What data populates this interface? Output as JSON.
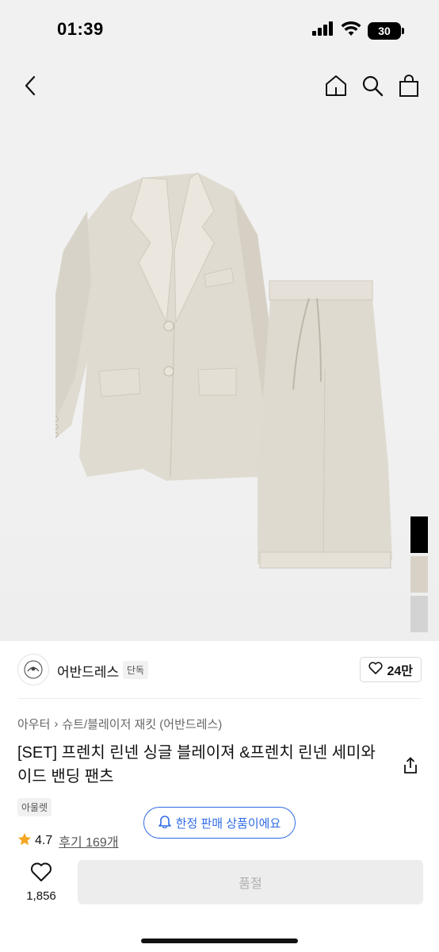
{
  "status_bar": {
    "time": "01:39",
    "battery": "30"
  },
  "nav": {
    "back_icon": "chevron-left-icon",
    "icons": [
      "home-icon",
      "search-icon",
      "shopping-bag-icon"
    ]
  },
  "product_image": {
    "description_icon": "linen-suit-set-image"
  },
  "swatches": [
    {
      "color": "#000000"
    },
    {
      "color": "#d8d2c6"
    },
    {
      "color": "#d3d3d3"
    }
  ],
  "brand": {
    "name": "어반드레스",
    "badge": "단독",
    "likes": "24만"
  },
  "breadcrumb": {
    "category": "아우터",
    "separator": "›",
    "subcategory": "슈트/블레이저 재킷 (어반드레스)"
  },
  "product": {
    "title": "[SET] 프렌치 린넨 싱글 블레이져 &프렌치 린넨 세미와이드 밴딩 팬츠",
    "outlet_tag": "아울렛",
    "limited_notice": "한정 판매 상품이에요"
  },
  "rating": {
    "value": "4.7",
    "reviews": "후기 169개",
    "star_color": "#f5a623"
  },
  "bottom_bar": {
    "wish_count": "1,856",
    "button_label": "품절"
  },
  "colors": {
    "accent": "#2f6be5",
    "soldout_bg": "#ededed"
  }
}
